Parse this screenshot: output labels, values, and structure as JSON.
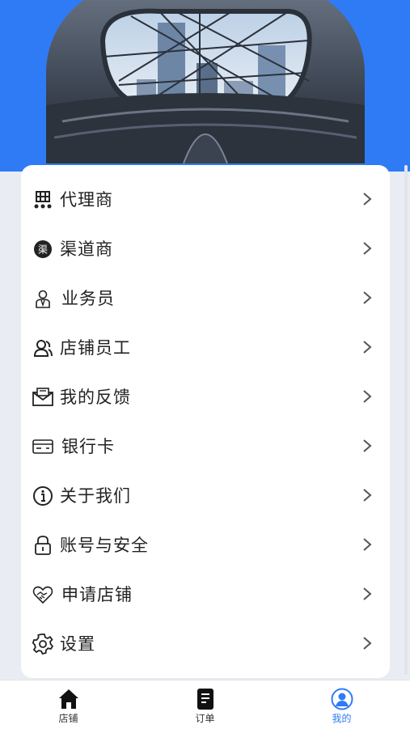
{
  "colors": {
    "accent": "#2f7bf5",
    "page_bg": "#e9edf3",
    "text": "#222222"
  },
  "menu": [
    {
      "label": "代理商",
      "icon": "agent-icon"
    },
    {
      "label": "渠道商",
      "icon": "channel-icon"
    },
    {
      "label": "业务员",
      "icon": "salesperson-icon"
    },
    {
      "label": "店铺员工",
      "icon": "staff-icon"
    },
    {
      "label": "我的反馈",
      "icon": "feedback-icon"
    },
    {
      "label": "银行卡",
      "icon": "bank-card-icon"
    },
    {
      "label": "关于我们",
      "icon": "info-icon"
    },
    {
      "label": "账号与安全",
      "icon": "lock-icon"
    },
    {
      "label": "申请店铺",
      "icon": "handshake-icon"
    },
    {
      "label": "设置",
      "icon": "gear-icon"
    }
  ],
  "tabs": [
    {
      "label": "店铺",
      "icon": "home-icon",
      "active": false
    },
    {
      "label": "订单",
      "icon": "order-icon",
      "active": false
    },
    {
      "label": "我的",
      "icon": "user-icon",
      "active": true
    }
  ],
  "channel_badge": "渠"
}
